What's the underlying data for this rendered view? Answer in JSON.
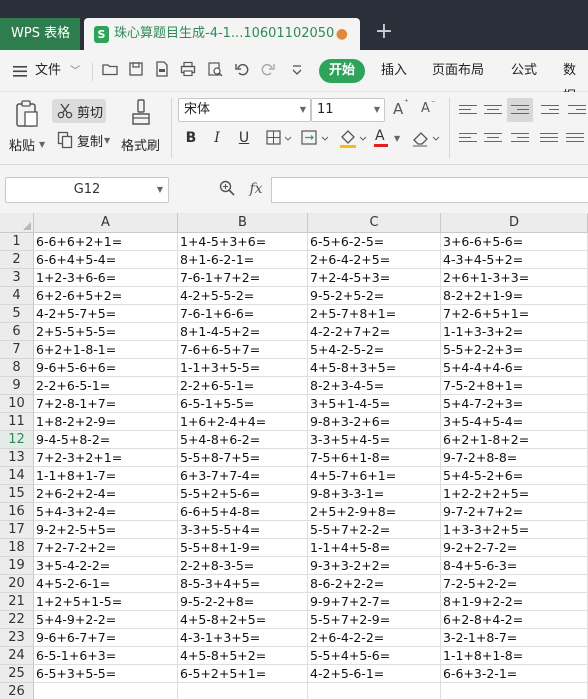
{
  "titlebar": {
    "app_tab": "WPS 表格",
    "doc_tab": "珠心算题目生成-4-1...10601102050",
    "doc_icon": "S",
    "modified_dot": "●",
    "new_tab": "+"
  },
  "menubar": {
    "file": "文件",
    "tabs": [
      "开始",
      "插入",
      "页面布局",
      "公式",
      "数据"
    ]
  },
  "ribbon": {
    "paste": "粘贴",
    "cut": "剪切",
    "copy": "复制",
    "format_painter": "格式刷",
    "font_name": "宋体",
    "font_size": "11",
    "bold": "B",
    "italic": "I",
    "underline": "U",
    "grow_font": "A",
    "shrink_font": "A",
    "font_color_glyph": "A"
  },
  "formula_bar": {
    "name_box": "G12",
    "fx": "fx",
    "formula": ""
  },
  "columns": [
    "A",
    "B",
    "C",
    "D"
  ],
  "selected_row": 12,
  "rows": [
    {
      "n": "1",
      "cells": [
        "6-6+6+2+1=",
        "1+4-5+3+6=",
        "6-5+6-2-5=",
        "3+6-6+5-6="
      ]
    },
    {
      "n": "2",
      "cells": [
        "6-6+4+5-4=",
        "8+1-6-2-1=",
        "2+6-4-2+5=",
        "4-3+4-5+2="
      ]
    },
    {
      "n": "3",
      "cells": [
        "1+2-3+6-6=",
        "7-6-1+7+2=",
        "7+2-4-5+3=",
        "2+6+1-3+3="
      ]
    },
    {
      "n": "4",
      "cells": [
        "6+2-6+5+2=",
        "4-2+5-5-2=",
        "9-5-2+5-2=",
        "8-2+2+1-9="
      ]
    },
    {
      "n": "5",
      "cells": [
        "4-2+5-7+5=",
        "7-6-1+6-6=",
        "2+5-7+8+1=",
        "7+2-6+5+1="
      ]
    },
    {
      "n": "6",
      "cells": [
        "2+5-5+5-5=",
        "8+1-4-5+2=",
        "4-2-2+7+2=",
        "1-1+3-3+2="
      ]
    },
    {
      "n": "7",
      "cells": [
        "6+2+1-8-1=",
        "7-6+6-5+7=",
        "5+4-2-5-2=",
        "5-5+2-2+3="
      ]
    },
    {
      "n": "8",
      "cells": [
        "9-6+5-6+6=",
        "1-1+3+5-5=",
        "4+5-8+3+5=",
        "5+4-4+4-6="
      ]
    },
    {
      "n": "9",
      "cells": [
        "2-2+6-5-1=",
        "2-2+6-5-1=",
        "8-2+3-4-5=",
        "7-5-2+8+1="
      ]
    },
    {
      "n": "10",
      "cells": [
        "7+2-8-1+7=",
        "6-5-1+5-5=",
        "3+5+1-4-5=",
        "5+4-7-2+3="
      ]
    },
    {
      "n": "11",
      "cells": [
        "1+8-2+2-9=",
        "1+6+2-4+4=",
        "9-8+3-2+6=",
        "3+5-4+5-4="
      ]
    },
    {
      "n": "12",
      "cells": [
        "9-4-5+8-2=",
        "5+4-8+6-2=",
        "3-3+5+4-5=",
        "6+2+1-8+2="
      ]
    },
    {
      "n": "13",
      "cells": [
        "7+2-3+2+1=",
        "5-5+8-7+5=",
        "7-5+6+1-8=",
        "9-7-2+8-8="
      ]
    },
    {
      "n": "14",
      "cells": [
        "1-1+8+1-7=",
        "6+3-7+7-4=",
        "4+5-7+6+1=",
        "5+4-5-2+6="
      ]
    },
    {
      "n": "15",
      "cells": [
        "2+6-2+2-4=",
        "5-5+2+5-6=",
        "9-8+3-3-1=",
        "1+2-2+2+5="
      ]
    },
    {
      "n": "16",
      "cells": [
        "5+4-3+2-4=",
        "6-6+5+4-8=",
        "2+5+2-9+8=",
        "9-7-2+7+2="
      ]
    },
    {
      "n": "17",
      "cells": [
        "9-2+2-5+5=",
        "3-3+5-5+4=",
        "5-5+7+2-2=",
        "1+3-3+2+5="
      ]
    },
    {
      "n": "18",
      "cells": [
        "7+2-7-2+2=",
        "5-5+8+1-9=",
        "1-1+4+5-8=",
        "9-2+2-7-2="
      ]
    },
    {
      "n": "19",
      "cells": [
        "3+5-4-2-2=",
        "2-2+8-3-5=",
        "9-3+3-2+2=",
        "8-4+5-6-3="
      ]
    },
    {
      "n": "20",
      "cells": [
        "4+5-2-6-1=",
        "8-5-3+4+5=",
        "8-6-2+2-2=",
        "7-2-5+2-2="
      ]
    },
    {
      "n": "21",
      "cells": [
        "1+2+5+1-5=",
        "9-5-2-2+8=",
        "9-9+7+2-7=",
        "8+1-9+2-2="
      ]
    },
    {
      "n": "22",
      "cells": [
        "5+4-9+2-2=",
        "4+5-8+2+5=",
        "5-5+7+2-9=",
        "6+2-8+4-2="
      ]
    },
    {
      "n": "23",
      "cells": [
        "9-6+6-7+7=",
        "4-3-1+3+5=",
        "2+6-4-2-2=",
        "3-2-1+8-7="
      ]
    },
    {
      "n": "24",
      "cells": [
        "6-5-1+6+3=",
        "4+5-8+5+2=",
        "5-5+4+5-6=",
        "1-1+8+1-8="
      ]
    },
    {
      "n": "25",
      "cells": [
        "6-5+3+5-5=",
        "6-5+2+5+1=",
        "4-2+5-6-1=",
        "6-6+3-2-1="
      ]
    },
    {
      "n": "26",
      "cells": [
        "",
        "",
        "",
        ""
      ]
    }
  ]
}
